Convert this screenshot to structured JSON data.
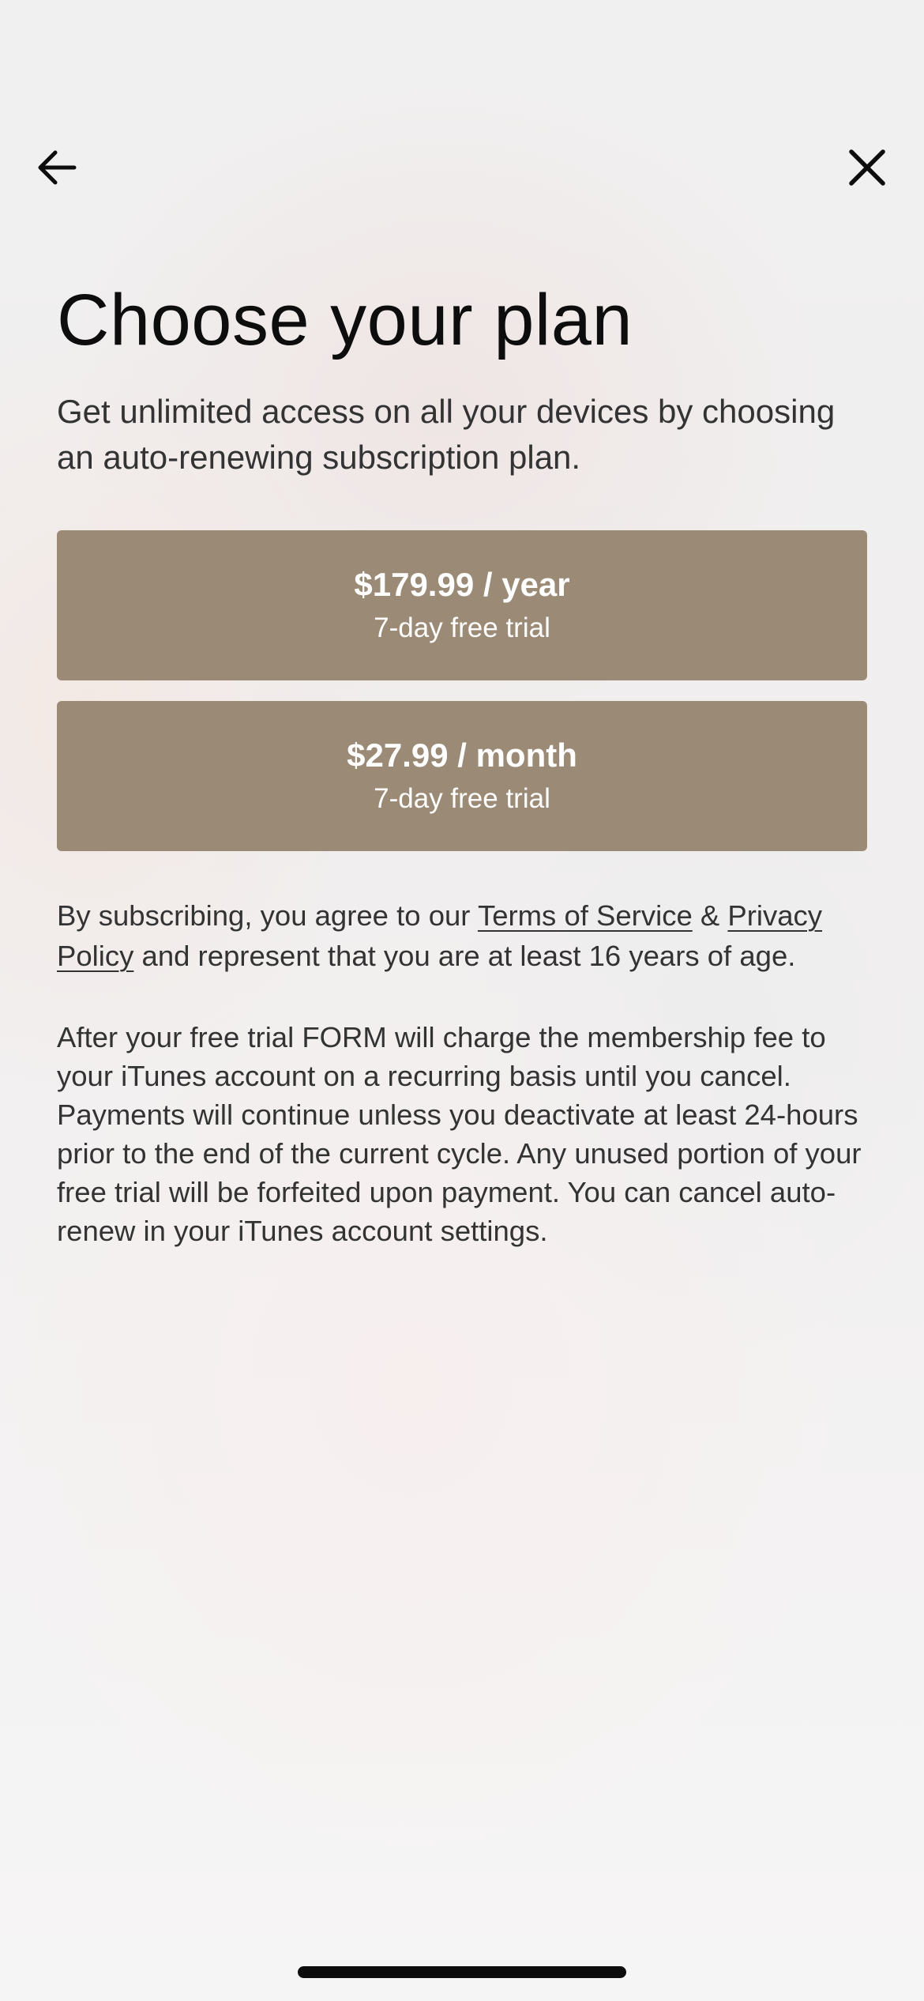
{
  "header": {
    "back_icon": "arrow-left-icon",
    "close_icon": "close-icon"
  },
  "title": "Choose your plan",
  "subtitle": "Get unlimited access on all your devices by choosing an auto-renewing subscription plan.",
  "plans": [
    {
      "price": "$179.99 / year",
      "trial": "7-day free trial"
    },
    {
      "price": "$27.99 / month",
      "trial": "7-day free trial"
    }
  ],
  "legal": {
    "prefix": "By subscribing, you agree to our ",
    "terms_link": "Terms of Service",
    "amp": " & ",
    "privacy_link": "Privacy Policy",
    "suffix": " and represent that you are at least 16 years of age."
  },
  "renewal_notice": "After your free trial FORM will charge the membership fee to your iTunes account on a recurring basis until you cancel. Payments will continue unless you deactivate at least 24-hours prior to the end of the current cycle. Any unused portion of your free trial will be forfeited upon payment. You can cancel auto-renew in your iTunes account settings.",
  "colors": {
    "plan_button": "#9b8a75",
    "text_primary": "#0d0d0d",
    "text_secondary": "#333333"
  }
}
